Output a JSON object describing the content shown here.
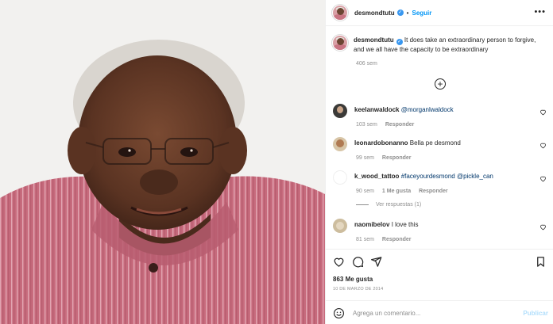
{
  "header": {
    "username": "desmondtutu",
    "separator": "•",
    "follow_label": "Seguir",
    "more_icon": "more-horizontal-icon"
  },
  "caption": {
    "username": "desmondtutu",
    "text": "It does take an extraordinary person to forgive, and we all have the capacity to be extraordinary",
    "time": "406 sem"
  },
  "comments": [
    {
      "username": "keelanwaldock",
      "text": "@morganlwaldock",
      "is_mention": true,
      "time": "103 sem",
      "reply": "Responder"
    },
    {
      "username": "leonardobonanno",
      "text": "Bella pe desmond",
      "time": "99 sem",
      "reply": "Responder"
    },
    {
      "username": "k_wood_tattoo",
      "text": "#faceyourdesmond @pickle_can",
      "time": "90 sem",
      "likes": "1 Me gusta",
      "reply": "Responder",
      "view_replies": "Ver respuestas (1)"
    },
    {
      "username": "naomibelov",
      "text": "I love this",
      "time": "81 sem",
      "reply": "Responder"
    }
  ],
  "actions": {
    "likes": "863 Me gusta",
    "date": "10 DE MARZO DE 2014"
  },
  "add_comment": {
    "placeholder": "Agrega un comentario...",
    "publish_label": "Publicar"
  },
  "colors": {
    "accent": "#0095f6",
    "verified": "#3897f0",
    "mention": "#00376b",
    "muted": "#8e8e8e",
    "publish_disabled": "#b2dffc"
  }
}
